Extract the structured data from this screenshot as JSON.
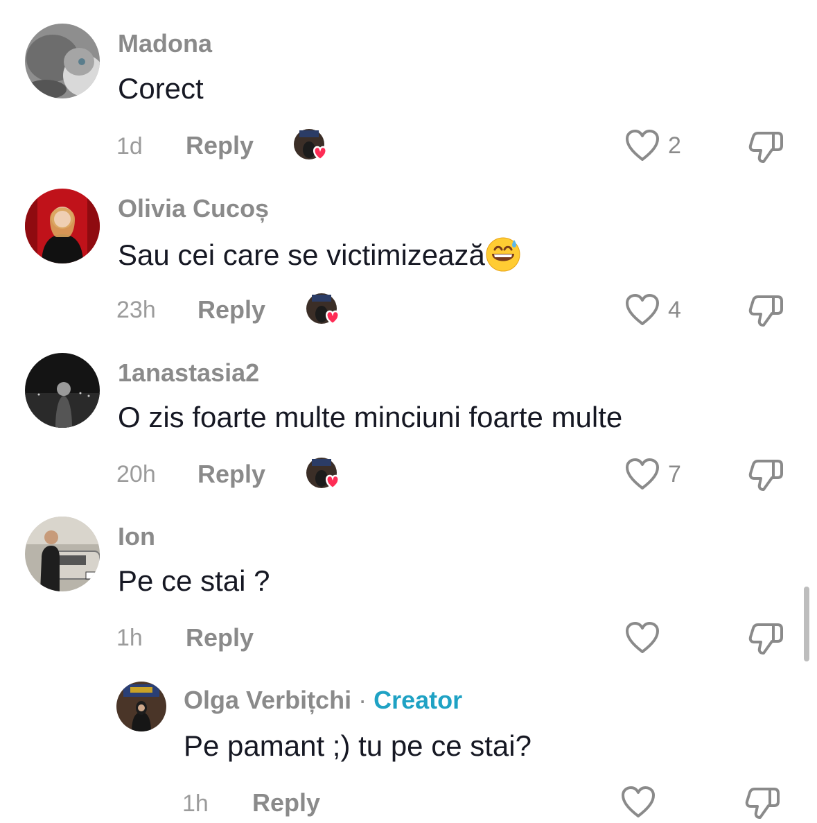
{
  "comments": [
    {
      "username": "Madona",
      "text": "Corect",
      "time": "1d",
      "reply_label": "Reply",
      "likes": "2",
      "avatar": "cat-photo-avatar",
      "creator_liked": true
    },
    {
      "username": "Olivia Cucoș",
      "text": "Sau cei care se victimizează",
      "emoji": "grinning-sweat-emoji",
      "time": "23h",
      "reply_label": "Reply",
      "likes": "4",
      "avatar": "red-curtain-portrait-avatar",
      "creator_liked": true
    },
    {
      "username": "1anastasia2",
      "text": "O zis foarte multe minciuni foarte multe",
      "time": "20h",
      "reply_label": "Reply",
      "likes": "7",
      "avatar": "dark-night-portrait-avatar",
      "creator_liked": true
    },
    {
      "username": "Ion",
      "text": "Pe ce stai ?",
      "time": "1h",
      "reply_label": "Reply",
      "likes": "",
      "avatar": "man-with-car-avatar",
      "creator_liked": false
    }
  ],
  "reply": {
    "username": "Olga Verbițchi",
    "separator": "·",
    "badge": "Creator",
    "text": "Pe pamant ;) tu pe ce stai?",
    "time": "1h",
    "reply_label": "Reply",
    "likes": "",
    "avatar": "creator-studio-avatar"
  },
  "colors": {
    "accent": "#1fa2c4",
    "heart": "#fe2c55",
    "muted": "#8a8a8a",
    "text": "#161823"
  },
  "icons": {
    "like": "heart-outline-icon",
    "dislike": "thumbs-down-outline-icon",
    "creator_like": "creator-liked-badge-icon"
  }
}
